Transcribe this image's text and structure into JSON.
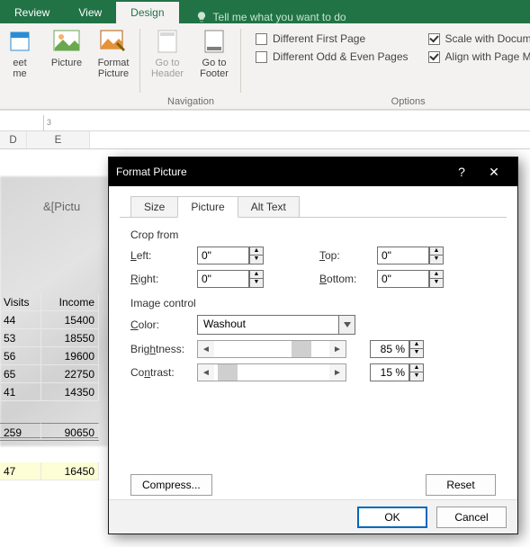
{
  "ribbon": {
    "tabs": {
      "review": "Review",
      "view": "View",
      "design": "Design"
    },
    "tell_me": "Tell me what you want to do",
    "btn_sheet": "eet\nme",
    "btn_picture": "Picture",
    "btn_format_picture": "Format\nPicture",
    "btn_goto_header": "Go to\nHeader",
    "btn_goto_footer": "Go to\nFooter",
    "group_nav": "Navigation",
    "group_opt": "Options",
    "chk_diff_first": "Different First Page",
    "chk_diff_odd": "Different Odd & Even Pages",
    "chk_scale": "Scale with Document",
    "chk_align": "Align with Page Margins"
  },
  "sheet": {
    "ruler_tick": "3",
    "col_d": "D",
    "col_e": "E",
    "header_token": "&[Pictu",
    "headers": {
      "visits": "Visits",
      "income": "Income"
    },
    "rows": [
      {
        "v": "44",
        "i": "15400"
      },
      {
        "v": "53",
        "i": "18550"
      },
      {
        "v": "56",
        "i": "19600"
      },
      {
        "v": "65",
        "i": "22750"
      },
      {
        "v": "41",
        "i": "14350"
      }
    ],
    "totals": {
      "v": "259",
      "i": "90650"
    },
    "extra": {
      "v": "47",
      "i": "16450"
    }
  },
  "dialog": {
    "title": "Format Picture",
    "help": "?",
    "close": "✕",
    "tabs": {
      "size": "Size",
      "picture": "Picture",
      "alttext": "Alt Text"
    },
    "crop_from": "Crop from",
    "left": "Left:",
    "right": "Right:",
    "top": "Top:",
    "bottom": "Bottom:",
    "zero": "0\"",
    "image_control": "Image control",
    "color": "Color:",
    "color_val": "Washout",
    "brightness": "Brightness:",
    "brightness_val": "85 %",
    "contrast": "Contrast:",
    "contrast_val": "15 %",
    "compress": "Compress...",
    "reset": "Reset",
    "ok": "OK",
    "cancel": "Cancel"
  }
}
